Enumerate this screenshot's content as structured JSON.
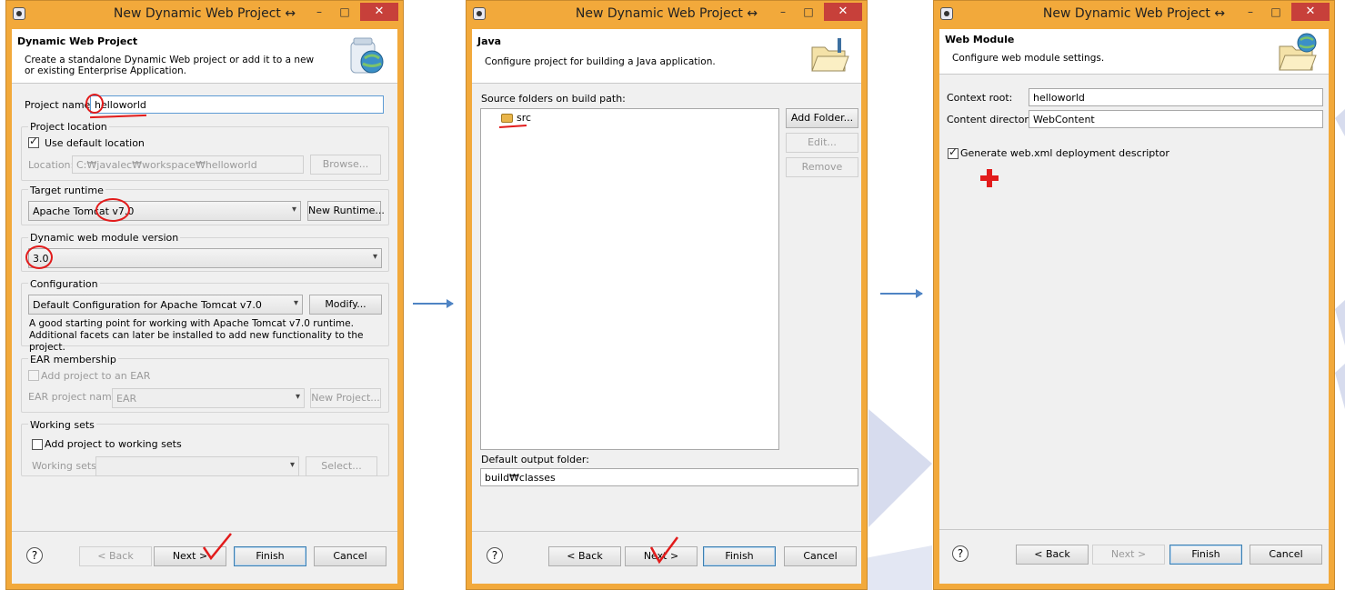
{
  "window1": {
    "title": "New Dynamic Web Project",
    "title_mark": "↔",
    "banner_heading": "Dynamic Web Project",
    "banner_desc": "Create a standalone Dynamic Web project or add it to a new or existing Enterprise Application.",
    "project_name_label": "Project name:",
    "project_name_value": "helloworld",
    "project_location_label": "Project location",
    "use_default_location_label": "Use default location",
    "location_label": "Location:",
    "location_value": "C:₩javalec₩workspace₩helloworld",
    "browse_label": "Browse...",
    "target_runtime_label": "Target runtime",
    "target_runtime_value": "Apache Tomcat v7.0",
    "new_runtime_label": "New Runtime...",
    "module_version_label": "Dynamic web module version",
    "module_version_value": "3.0",
    "configuration_label": "Configuration",
    "configuration_value": "Default Configuration for Apache Tomcat v7.0",
    "modify_label": "Modify...",
    "configuration_desc": "A good starting point for working with Apache Tomcat v7.0 runtime. Additional facets can later be installed to add new functionality to the project.",
    "ear_membership_label": "EAR membership",
    "add_to_ear_label": "Add project to an EAR",
    "ear_project_name_label": "EAR project name:",
    "ear_project_name_value": "EAR",
    "new_project_label": "New Project...",
    "working_sets_label": "Working sets",
    "add_to_working_sets_label": "Add project to working sets",
    "working_sets_field_label": "Working sets:",
    "select_label": "Select...",
    "back_label": "< Back",
    "next_label": "Next >",
    "finish_label": "Finish",
    "cancel_label": "Cancel"
  },
  "window2": {
    "title": "New Dynamic Web Project",
    "title_mark": "↔",
    "banner_heading": "Java",
    "banner_desc": "Configure project for building a Java application.",
    "source_folders_label": "Source folders on build path:",
    "source_folder_item": "src",
    "add_folder_label": "Add Folder...",
    "edit_label": "Edit...",
    "remove_label": "Remove",
    "default_output_label": "Default output folder:",
    "default_output_value": "build₩classes",
    "back_label": "< Back",
    "next_label": "Next >",
    "finish_label": "Finish",
    "cancel_label": "Cancel"
  },
  "window3": {
    "title": "New Dynamic Web Project",
    "title_mark": "↔",
    "banner_heading": "Web Module",
    "banner_desc": "Configure web module settings.",
    "context_root_label": "Context root:",
    "context_root_value": "helloworld",
    "content_directory_label": "Content directory:",
    "content_directory_value": "WebContent",
    "generate_webxml_label": "Generate web.xml deployment descriptor",
    "back_label": "< Back",
    "next_label": "Next >",
    "finish_label": "Finish",
    "cancel_label": "Cancel"
  },
  "window_controls": {
    "minimize": "–",
    "maximize": "□",
    "close": "✕"
  },
  "help_symbol": "?",
  "colors": {
    "accent_window": "#f2a93b",
    "annotation": "#e21b1b",
    "flow_arrow": "#4f84c4",
    "close_button": "#c7403a"
  }
}
